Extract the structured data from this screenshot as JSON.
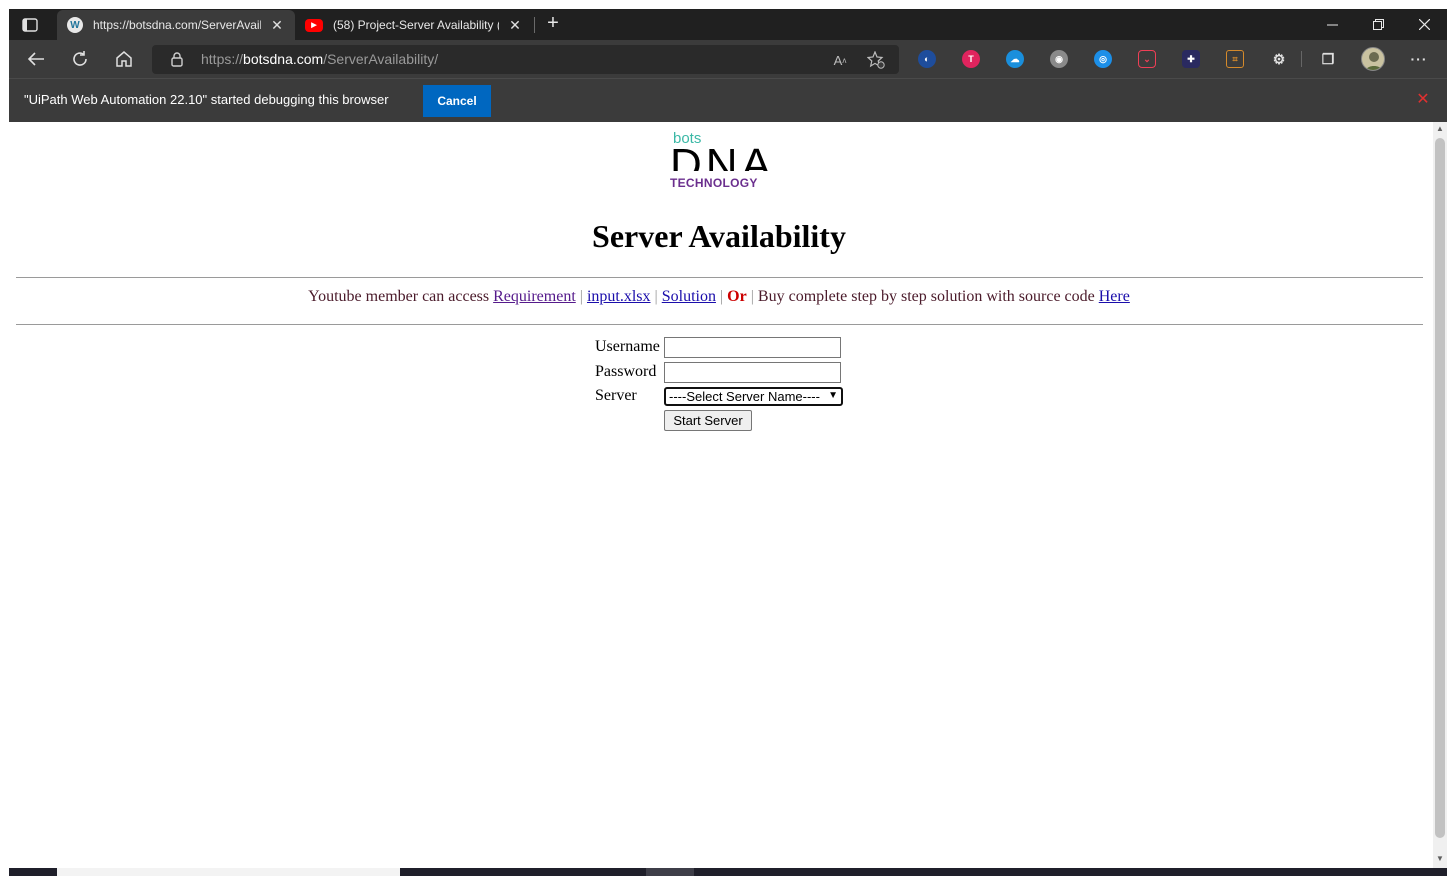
{
  "tabs": [
    {
      "title": "https://botsdna.com/ServerAvail",
      "active": true,
      "favicon": "wordpress-icon"
    },
    {
      "title": "(58) Project-Server Availability (C",
      "active": false,
      "favicon": "youtube-icon"
    }
  ],
  "address": {
    "scheme": "https://",
    "host": "botsdna.com",
    "path": "/ServerAvailability/"
  },
  "extensions": [
    "extension-1-icon",
    "extension-2-icon",
    "extension-3-icon",
    "extension-4-icon",
    "extension-5-icon",
    "pocket-icon",
    "extension-7-icon",
    "extension-8-icon",
    "puzzle-icon",
    "collections-icon"
  ],
  "infobar": {
    "message": "\"UiPath Web Automation 22.10\" started debugging this browser",
    "cancel_label": "Cancel"
  },
  "logo": {
    "line1": "bots",
    "line2": "DNA",
    "line3": "TECHNOLOGY"
  },
  "page": {
    "title": "Server Availability",
    "intro": "Youtube member can access ",
    "link_requirement": "Requirement",
    "link_input": "input.xlsx",
    "link_solution": "Solution",
    "or": "Or",
    "buy_text": "Buy complete step by step solution with source code ",
    "link_here": "Here",
    "pipe": "|"
  },
  "form": {
    "username_label": "Username",
    "password_label": "Password",
    "server_label": "Server",
    "server_selected": "----Select Server Name----",
    "start_label": "Start Server"
  },
  "colors": {
    "accent_blue": "#0067c0",
    "or_red": "#cc0000",
    "logo_teal": "#3bb8a6",
    "logo_purple": "#6b2f8e"
  }
}
